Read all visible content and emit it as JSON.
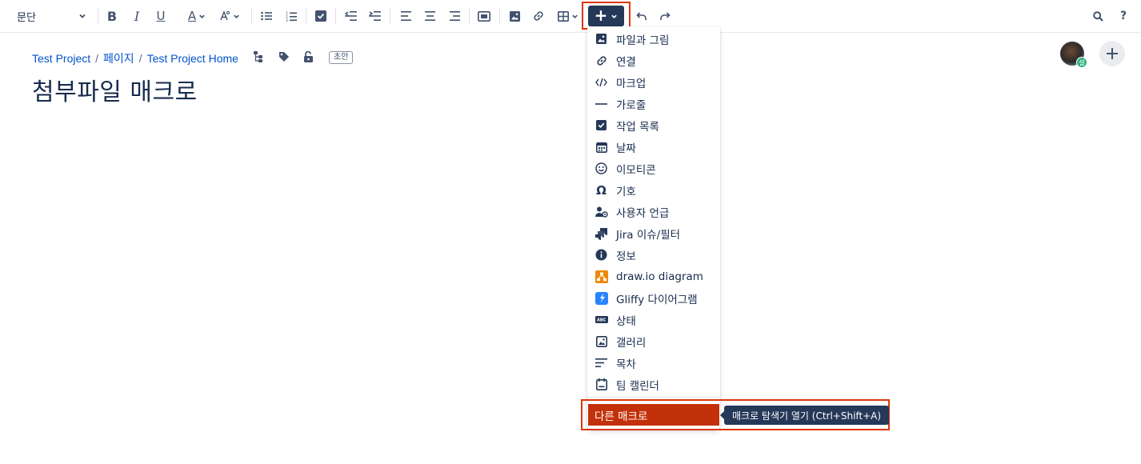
{
  "toolbar": {
    "paragraph_select": "문단",
    "buttons": {
      "bold": "B",
      "italic": "I",
      "underline": "U",
      "text_color": "A",
      "insert_more": "+",
      "help": "?"
    },
    "icons": [
      "chevron-down-icon",
      "bold-icon",
      "italic-icon",
      "underline-icon",
      "text-color-icon",
      "clear-format-icon",
      "bullet-list-icon",
      "numbered-list-icon",
      "task-icon",
      "outdent-icon",
      "indent-icon",
      "align-left-icon",
      "align-center-icon",
      "align-right-icon",
      "layout-icon",
      "image-icon",
      "link-icon",
      "table-icon",
      "plus-icon",
      "undo-icon",
      "redo-icon",
      "search-icon",
      "help-icon"
    ]
  },
  "breadcrumb": {
    "items": [
      "Test Project",
      "페이지",
      "Test Project Home"
    ],
    "separator": "/",
    "draft_badge": "초안"
  },
  "page": {
    "title": "첨부파일 매크로"
  },
  "avatar": {
    "badge": "설"
  },
  "insert_menu": {
    "items": [
      {
        "label": "파일과 그림",
        "icon": "image-icon"
      },
      {
        "label": "연결",
        "icon": "link-icon"
      },
      {
        "label": "마크업",
        "icon": "code-icon"
      },
      {
        "label": "가로줄",
        "icon": "horizontal-rule-icon"
      },
      {
        "label": "작업 목록",
        "icon": "checkbox-icon"
      },
      {
        "label": "날짜",
        "icon": "calendar-icon"
      },
      {
        "label": "이모티콘",
        "icon": "emoji-icon"
      },
      {
        "label": "기호",
        "icon": "omega-icon"
      },
      {
        "label": "사용자 언급",
        "icon": "mention-icon"
      },
      {
        "label": "Jira 이슈/필터",
        "icon": "jira-icon"
      },
      {
        "label": "정보",
        "icon": "info-icon"
      },
      {
        "label": "draw.io diagram",
        "icon": "drawio-icon"
      },
      {
        "label": "Gliffy 다이어그램",
        "icon": "gliffy-icon"
      },
      {
        "label": "상태",
        "icon": "status-icon"
      },
      {
        "label": "갤러리",
        "icon": "gallery-icon"
      },
      {
        "label": "목차",
        "icon": "toc-icon"
      },
      {
        "label": "팀 캘린더",
        "icon": "team-calendar-icon"
      }
    ],
    "other_macros": "다른 매크로"
  },
  "tooltip": {
    "text": "매크로 탐색기 열기 (Ctrl+Shift+A)"
  },
  "colors": {
    "accent": "#0052cc",
    "insert_button": "#253858",
    "highlight_red": "#de350b",
    "selected_item": "#c3310a"
  }
}
